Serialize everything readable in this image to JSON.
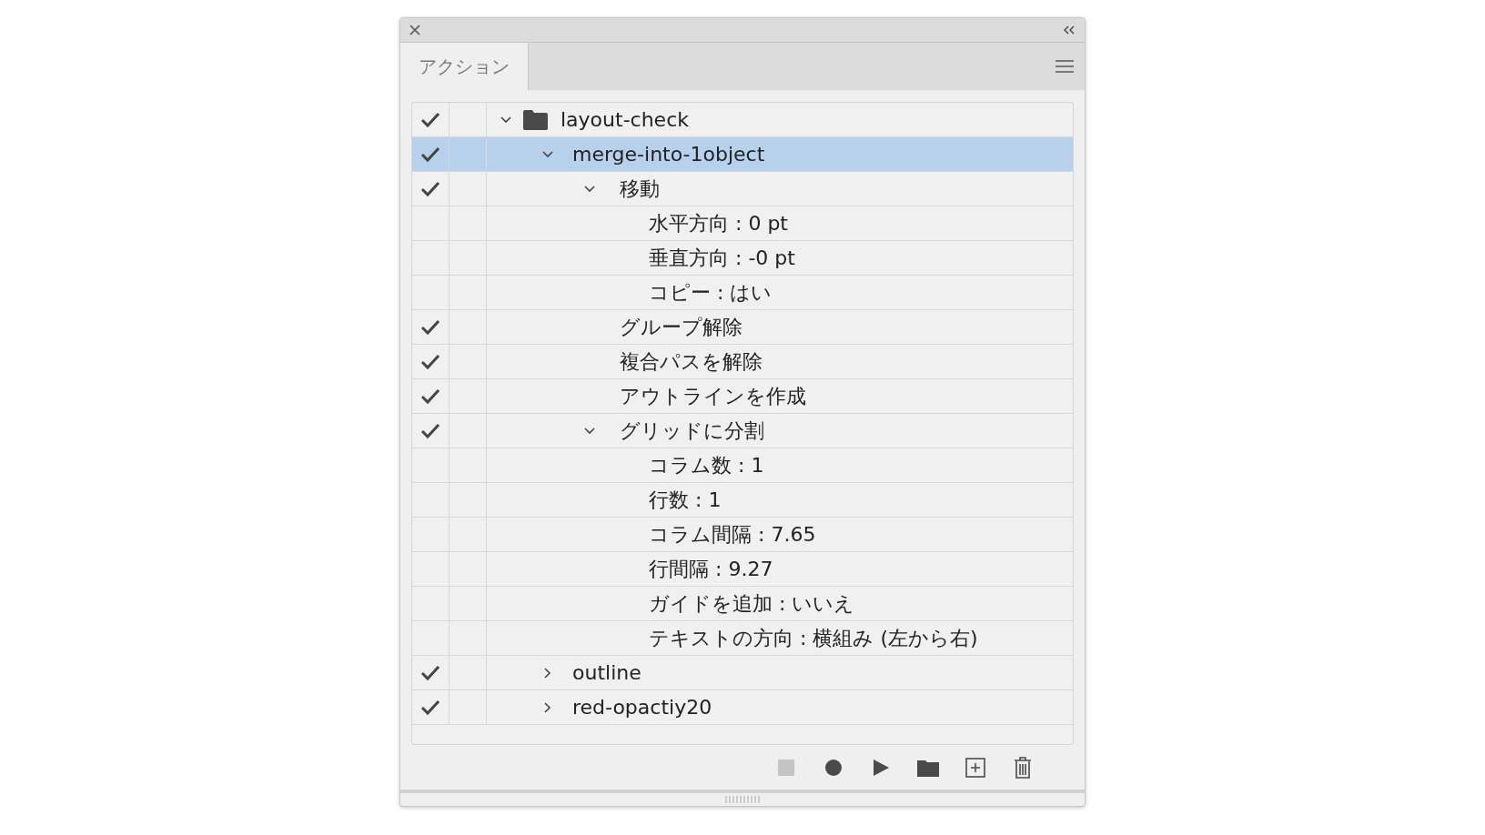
{
  "panel": {
    "tab": {
      "label": "アクション",
      "selected": true
    }
  },
  "actions": [
    {
      "label": "layout-check",
      "kind": "set",
      "checked": true,
      "selected": false,
      "expanded": true,
      "children": [
        {
          "label": "merge-into-1object",
          "kind": "action",
          "checked": true,
          "selected": true,
          "expanded": true,
          "children": [
            {
              "label": "移動",
              "kind": "command",
              "checked": true,
              "selected": false,
              "expanded": true,
              "children": [
                {
                  "label": "水平方向 : 0 pt",
                  "checked": false,
                  "selected": false
                },
                {
                  "label": "垂直方向 : -0 pt",
                  "checked": false,
                  "selected": false
                },
                {
                  "label": "コピー : はい",
                  "checked": false,
                  "selected": false
                }
              ]
            },
            {
              "label": "グループ解除",
              "kind": "command",
              "checked": true,
              "selected": false
            },
            {
              "label": "複合パスを解除",
              "kind": "command",
              "checked": true,
              "selected": false
            },
            {
              "label": "アウトラインを作成",
              "kind": "command",
              "checked": true,
              "selected": false
            },
            {
              "label": "グリッドに分割",
              "kind": "command",
              "checked": true,
              "selected": false,
              "expanded": true,
              "children": [
                {
                  "label": "コラム数 : 1",
                  "checked": false,
                  "selected": false
                },
                {
                  "label": "行数 : 1",
                  "checked": false,
                  "selected": false
                },
                {
                  "label": "コラム間隔 : 7.65",
                  "checked": false,
                  "selected": false
                },
                {
                  "label": "行間隔 : 9.27",
                  "checked": false,
                  "selected": false
                },
                {
                  "label": "ガイドを追加 : いいえ",
                  "checked": false,
                  "selected": false
                },
                {
                  "label": "テキストの方向 : 横組み (左から右)",
                  "checked": false,
                  "selected": false
                }
              ]
            }
          ]
        },
        {
          "label": "outline",
          "kind": "action",
          "checked": true,
          "selected": false,
          "expanded": false
        },
        {
          "label": "red-opactiy20",
          "kind": "action",
          "checked": true,
          "selected": false,
          "expanded": false
        }
      ]
    }
  ],
  "toolbar": {
    "stop_disabled": true
  }
}
